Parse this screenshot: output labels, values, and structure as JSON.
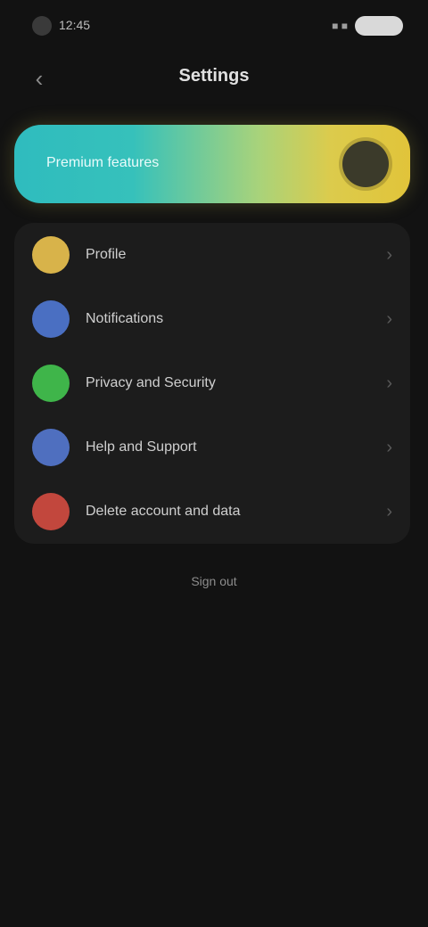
{
  "status_bar": {
    "time": "12:45",
    "signal": "■ ■",
    "battery_icon": "battery-icon"
  },
  "header": {
    "back_icon": "back-arrow-icon",
    "title": "Settings"
  },
  "promo": {
    "label": "Premium features",
    "toggle_icon": "toggle-knob-icon",
    "gradient": [
      "#2fbcbe",
      "#dccb4c"
    ]
  },
  "list": {
    "items": [
      {
        "label": "Profile",
        "color": "#d8b34a",
        "icon": "profile-icon"
      },
      {
        "label": "Notifications",
        "color": "#4a6fc2",
        "icon": "bell-icon"
      },
      {
        "label": "Privacy and Security",
        "color": "#3fb54a",
        "icon": "lock-icon"
      },
      {
        "label": "Help and Support",
        "color": "#4f6fbf",
        "icon": "help-icon"
      },
      {
        "label": "Delete account and data",
        "color": "#c2473d",
        "icon": "trash-icon"
      }
    ],
    "chevron": "›"
  },
  "footer": {
    "label": "Sign out"
  }
}
